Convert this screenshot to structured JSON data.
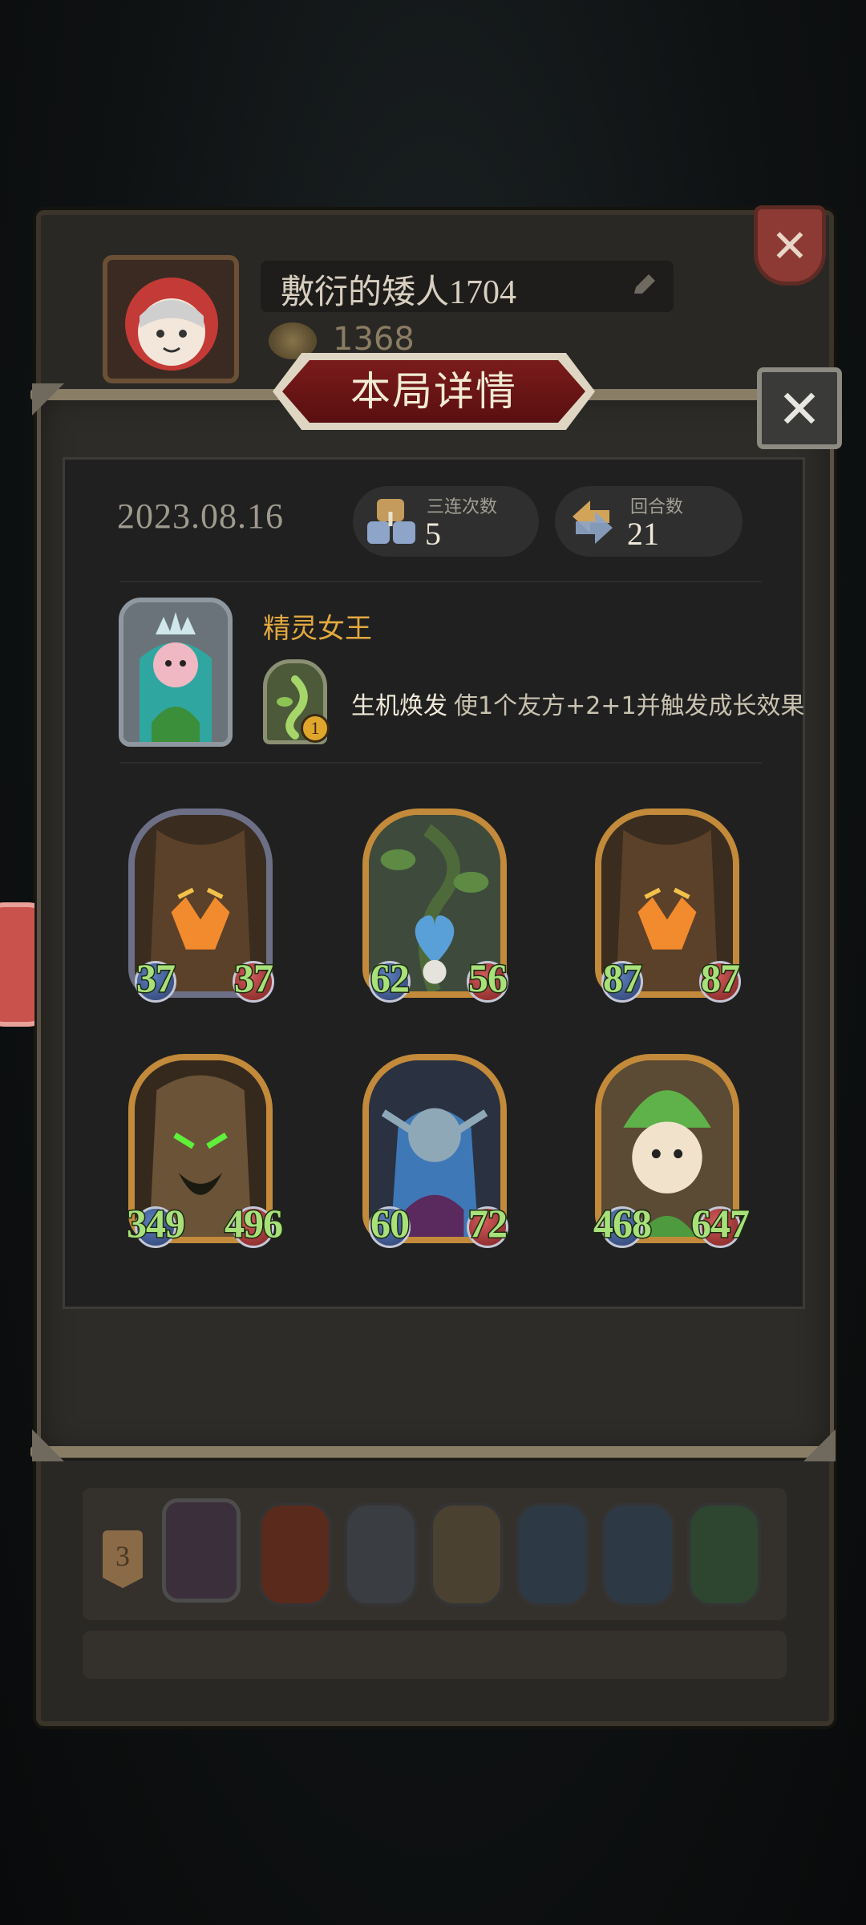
{
  "profile": {
    "name": "敷衍的矮人1704",
    "coins": "1368"
  },
  "history": {
    "rank": "3"
  },
  "modal": {
    "title": "本局详情",
    "date": "2023.08.16",
    "stats": {
      "triples_label": "三连次数",
      "triples_value": "5",
      "rounds_label": "回合数",
      "rounds_value": "21"
    },
    "hero": {
      "name": "精灵女王",
      "skill_level": "1",
      "skill_name": "生机焕发",
      "skill_desc": "使1个友方+2+1并触发成长效果"
    },
    "units": [
      {
        "atk": "37",
        "hp": "37",
        "frame": "silver",
        "art": "treant-icon"
      },
      {
        "atk": "62",
        "hp": "56",
        "frame": "gold",
        "art": "vine-heart-icon"
      },
      {
        "atk": "87",
        "hp": "87",
        "frame": "gold",
        "art": "treant-icon"
      },
      {
        "atk": "349",
        "hp": "496",
        "frame": "gold",
        "art": "ancient-tree-icon"
      },
      {
        "atk": "60",
        "hp": "72",
        "frame": "gold",
        "art": "dark-elf-icon"
      },
      {
        "atk": "468",
        "hp": "647",
        "frame": "gold",
        "art": "leaf-sprite-icon"
      }
    ]
  },
  "colors": {
    "accent_gold": "#e3a93f",
    "stat_green": "#a8e07a",
    "title_red": "#7a1b1b"
  }
}
